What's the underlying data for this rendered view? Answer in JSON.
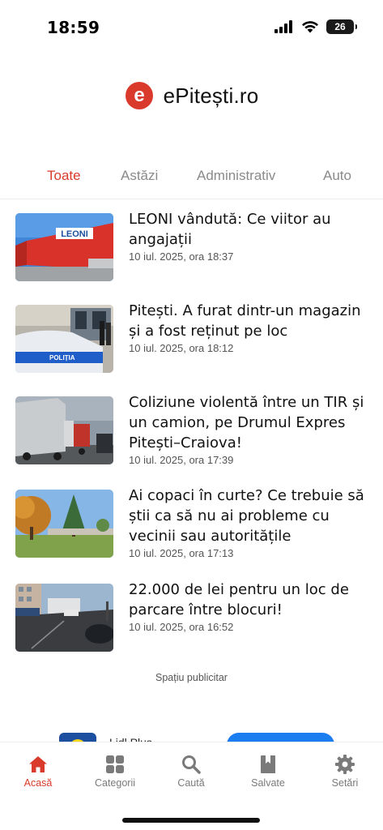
{
  "status_bar": {
    "time": "18:59",
    "battery": "26",
    "icons": [
      "cellular-signal-icon",
      "wifi-icon",
      "battery-icon"
    ]
  },
  "app": {
    "logo_letter": "e",
    "name": "ePitești.ro",
    "brand_color": "#d93a2b"
  },
  "tabs": [
    {
      "label": "Toate",
      "active": true
    },
    {
      "label": "Astăzi",
      "active": false
    },
    {
      "label": "Administrativ",
      "active": false
    },
    {
      "label": "Auto",
      "active": false
    }
  ],
  "articles": [
    {
      "title": "LEONI vândută: Ce viitor au angajații",
      "date": "10 iul. 2025, ora 18:37",
      "thumb_text": "LEONI"
    },
    {
      "title": "Pitești. A furat dintr-un magazin și a fost reținut pe loc",
      "date": "10 iul. 2025, ora 18:12",
      "thumb_text": "POLIȚIA"
    },
    {
      "title": "Coliziune violentă între un TIR și un camion, pe Drumul Expres Pitești–Craiova!",
      "date": "10 iul. 2025, ora 17:39"
    },
    {
      "title": "Ai copaci în curte? Ce trebuie să știi ca să nu ai probleme cu vecinii sau autoritățile",
      "date": "10 iul. 2025, ora 17:13"
    },
    {
      "title": "22.000 de lei pentru un loc de parcare între blocuri!",
      "date": "10 iul. 2025, ora 16:52"
    }
  ],
  "ad": {
    "label": "Spațiu publicitar",
    "title": "Lidl Plus"
  },
  "bottom_nav": [
    {
      "label": "Acasă",
      "icon": "home-icon",
      "active": true
    },
    {
      "label": "Categorii",
      "icon": "grid-icon",
      "active": false
    },
    {
      "label": "Caută",
      "icon": "search-icon",
      "active": false
    },
    {
      "label": "Salvate",
      "icon": "bookmark-icon",
      "active": false
    },
    {
      "label": "Setări",
      "icon": "gear-icon",
      "active": false
    }
  ],
  "colors": {
    "accent": "#d93a2b",
    "inactive": "#7a7a7a"
  }
}
